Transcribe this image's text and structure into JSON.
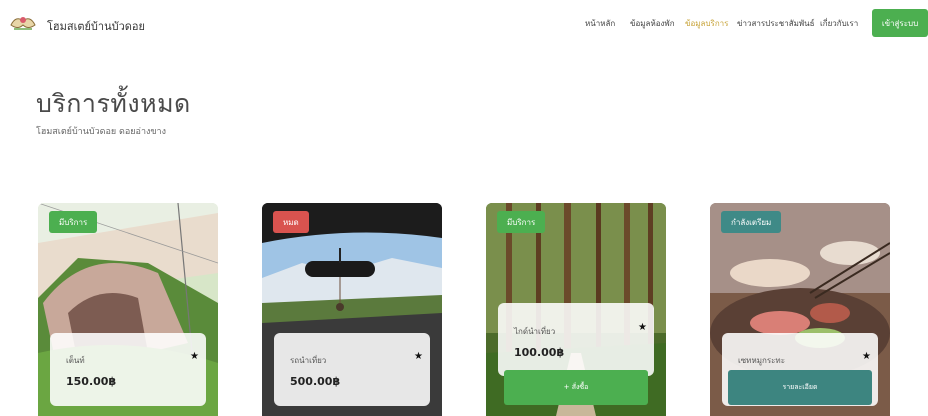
{
  "header": {
    "brand": "โฮมสเตย์บ้านบัวดอย",
    "nav": [
      "หน้าหลัก",
      "ข้อมูลห้องพัก",
      "ข้อมูลบริการ",
      "ข่าวสารประชาสัมพันธ์",
      "เกี่ยวกับเรา"
    ],
    "active_nav": "ข้อมูลบริการ",
    "login": "เข้าสู่ระบบ"
  },
  "page": {
    "title": "บริการทั้งหมด",
    "subtitle": "โฮมสเตย์บ้านบัวดอย ดอยอ่างขาง"
  },
  "cards": [
    {
      "badge": "มีบริการ",
      "badge_color": "#4caf50",
      "name": "เต็นท์",
      "price": "150.00฿",
      "star": "★"
    },
    {
      "badge": "หมด",
      "badge_color": "#d9534f",
      "name": "รถนำเที่ยว",
      "price": "500.00฿",
      "star": "★"
    },
    {
      "badge": "มีบริการ",
      "badge_color": "#4caf50",
      "name": "ไกด์นำเที่ยว",
      "price": "100.00฿",
      "star": "★",
      "button": "+ สั่งซื้อ",
      "button_color": "#4caf50"
    },
    {
      "badge": "กำลังเตรียม",
      "badge_color": "#3f8a87",
      "name": "เซทหมูกระทะ",
      "star": "★",
      "button": "รายละเอียด",
      "button_color": "#3d8580"
    }
  ]
}
